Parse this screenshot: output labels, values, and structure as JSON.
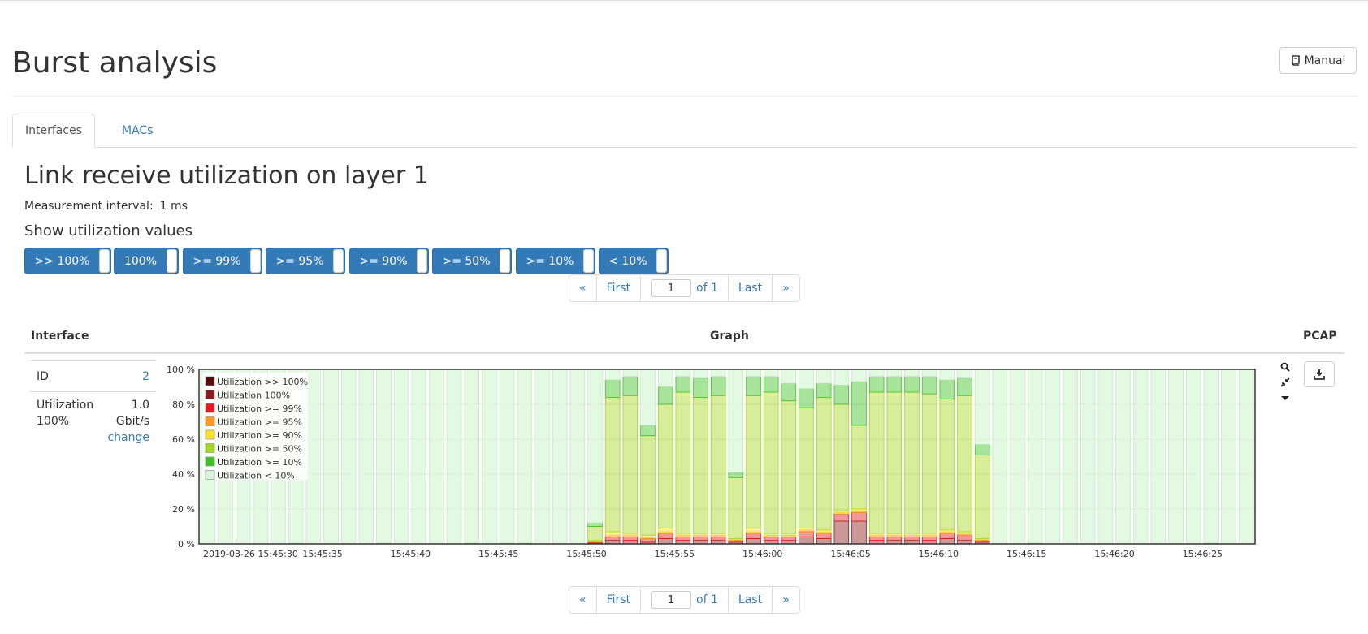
{
  "page": {
    "title": "Burst analysis",
    "manual_label": "Manual"
  },
  "tabs": [
    {
      "label": "Interfaces",
      "active": true
    },
    {
      "label": "MACs",
      "active": false
    }
  ],
  "section": {
    "title": "Link receive utilization on layer 1",
    "interval_label": "Measurement interval:",
    "interval_value": "1 ms",
    "show_title": "Show utilization values"
  },
  "toggles": [
    ">> 100%",
    "100%",
    ">= 99%",
    ">= 95%",
    ">= 90%",
    ">= 50%",
    ">= 10%",
    "< 10%"
  ],
  "pagination": {
    "prev": "«",
    "first": "First",
    "page": "1",
    "of": "of 1",
    "last": "Last",
    "next": "»"
  },
  "table": {
    "headers": {
      "interface": "Interface",
      "graph": "Graph",
      "pcap": "PCAP"
    },
    "interface": {
      "id_label": "ID",
      "id_value": "2",
      "util_label1": "Utilization",
      "util_label2": "100%",
      "util_value1": "1.0",
      "util_value2": "Gbit/s",
      "change": "change"
    }
  },
  "colors": {
    "accent": "#337ab7",
    "gt100": "#5a0808",
    "eq100": "#8b1a1a",
    "ge99": "#e41a1c",
    "ge95": "#ff9a1a",
    "ge90": "#ffe021",
    "ge50": "#a6d81e",
    "ge10": "#3ec422",
    "lt10": "#d9f6d6"
  },
  "chart_data": {
    "type": "bar",
    "stacked": true,
    "y_unit": "%",
    "ylim": [
      0,
      100
    ],
    "y_ticks": [
      "0 %",
      "20 %",
      "40 %",
      "60 %",
      "80 %",
      "100 %"
    ],
    "x_tick_labels": [
      "2019-03-26 15:45:30",
      "15:45:35",
      "15:45:40",
      "15:45:45",
      "15:45:50",
      "15:45:55",
      "15:46:00",
      "15:46:05",
      "15:46:10",
      "15:46:15",
      "15:46:20",
      "15:46:25"
    ],
    "x_start_label": "2019-03-26 15:45:30",
    "bar_interval_seconds": 1,
    "legend_position": "top-left",
    "series": [
      {
        "name": "Utilization >> 100%",
        "color": "#5a0808"
      },
      {
        "name": "Utilization 100%",
        "color": "#8b1a1a"
      },
      {
        "name": "Utilization >= 99%",
        "color": "#e41a1c"
      },
      {
        "name": "Utilization >= 95%",
        "color": "#ff9a1a"
      },
      {
        "name": "Utilization >= 90%",
        "color": "#ffe021"
      },
      {
        "name": "Utilization >= 50%",
        "color": "#a6d81e"
      },
      {
        "name": "Utilization >= 10%",
        "color": "#3ec422"
      },
      {
        "name": "Utilization < 10%",
        "color": "#d9f6d6"
      }
    ],
    "bars": [
      {
        "t": 0,
        "p": [
          0,
          0,
          0,
          0,
          0,
          0,
          0,
          100
        ]
      },
      {
        "t": 1,
        "p": [
          0,
          0,
          0,
          0,
          0,
          0,
          0,
          100
        ]
      },
      {
        "t": 2,
        "p": [
          0,
          0,
          0,
          0,
          0,
          0,
          0,
          100
        ]
      },
      {
        "t": 3,
        "p": [
          0,
          0,
          0,
          0,
          0,
          0,
          0,
          100
        ]
      },
      {
        "t": 4,
        "p": [
          0,
          0,
          0,
          0,
          0,
          0,
          0,
          100
        ]
      },
      {
        "t": 5,
        "p": [
          0,
          0,
          0,
          0,
          0,
          0,
          0.5,
          99.5
        ]
      },
      {
        "t": 6,
        "p": [
          0,
          0,
          0,
          0,
          0,
          0,
          0,
          100
        ]
      },
      {
        "t": 7,
        "p": [
          0,
          0,
          0,
          0,
          0,
          0,
          0,
          100
        ]
      },
      {
        "t": 8,
        "p": [
          0,
          0,
          0,
          0,
          0,
          0,
          0,
          100
        ]
      },
      {
        "t": 9,
        "p": [
          0,
          0,
          0,
          0,
          0,
          0,
          0,
          100
        ]
      },
      {
        "t": 10,
        "p": [
          0,
          0,
          0,
          0,
          0,
          0,
          0.5,
          99.5
        ]
      },
      {
        "t": 11,
        "p": [
          0,
          0,
          0,
          0,
          0,
          0,
          0,
          100
        ]
      },
      {
        "t": 12,
        "p": [
          0,
          0,
          0,
          0,
          0,
          0,
          0,
          100
        ]
      },
      {
        "t": 13,
        "p": [
          0,
          0,
          0,
          0,
          0,
          0,
          0,
          100
        ]
      },
      {
        "t": 14,
        "p": [
          0,
          0,
          0,
          0,
          0,
          0,
          0,
          100
        ]
      },
      {
        "t": 15,
        "p": [
          0,
          0,
          0,
          0,
          0,
          0,
          0.5,
          99.5
        ]
      },
      {
        "t": 16,
        "p": [
          0,
          0,
          0,
          0,
          0,
          0,
          0,
          100
        ]
      },
      {
        "t": 17,
        "p": [
          0,
          0,
          0,
          0,
          0,
          0,
          0.5,
          99.5
        ]
      },
      {
        "t": 18,
        "p": [
          0,
          0,
          0,
          0,
          0,
          0,
          0.5,
          99.5
        ]
      },
      {
        "t": 19,
        "p": [
          0,
          0,
          0,
          0,
          0,
          0,
          0,
          100
        ]
      },
      {
        "t": 20,
        "p": [
          0,
          0,
          0,
          0,
          0,
          0,
          0,
          100
        ]
      },
      {
        "t": 21,
        "p": [
          0,
          0,
          0,
          0,
          0,
          0,
          0,
          100
        ]
      },
      {
        "t": 22,
        "p": [
          0,
          0.5,
          0.5,
          0.5,
          0.5,
          8,
          2,
          88
        ]
      },
      {
        "t": 23,
        "p": [
          0,
          2,
          2,
          1,
          2,
          77,
          10,
          6
        ]
      },
      {
        "t": 24,
        "p": [
          0,
          2,
          2,
          1,
          1,
          79,
          11,
          4
        ]
      },
      {
        "t": 25,
        "p": [
          0,
          1,
          2,
          1,
          1,
          57,
          6,
          32
        ]
      },
      {
        "t": 26,
        "p": [
          0,
          3,
          3,
          1,
          2,
          71,
          10,
          10
        ]
      },
      {
        "t": 27,
        "p": [
          0,
          2,
          2,
          1,
          1,
          81,
          9,
          4
        ]
      },
      {
        "t": 28,
        "p": [
          0,
          2,
          2,
          1,
          1,
          78,
          11,
          5
        ]
      },
      {
        "t": 29,
        "p": [
          0,
          2,
          2,
          1,
          1,
          79,
          11,
          4
        ]
      },
      {
        "t": 30,
        "p": [
          0,
          1,
          1,
          0.5,
          0.5,
          35,
          3,
          59
        ]
      },
      {
        "t": 31,
        "p": [
          0,
          3,
          3,
          1,
          2,
          76,
          11,
          4
        ]
      },
      {
        "t": 32,
        "p": [
          0,
          2,
          2,
          1,
          1,
          81,
          9,
          4
        ]
      },
      {
        "t": 33,
        "p": [
          0,
          2,
          2,
          1,
          1,
          76,
          10,
          8
        ]
      },
      {
        "t": 34,
        "p": [
          0,
          4,
          3,
          1,
          1,
          69,
          11,
          11
        ]
      },
      {
        "t": 35,
        "p": [
          0,
          3,
          3,
          1,
          1,
          76,
          8,
          8
        ]
      },
      {
        "t": 36,
        "p": [
          0,
          13,
          4,
          1,
          1,
          61,
          11,
          9
        ]
      },
      {
        "t": 37,
        "p": [
          0,
          13,
          5,
          1,
          1,
          48,
          25,
          7
        ]
      },
      {
        "t": 38,
        "p": [
          0,
          2,
          2,
          1,
          1,
          81,
          9,
          4
        ]
      },
      {
        "t": 39,
        "p": [
          0,
          2,
          2,
          1,
          1,
          81,
          9,
          4
        ]
      },
      {
        "t": 40,
        "p": [
          0,
          2,
          2,
          1,
          1,
          81,
          9,
          4
        ]
      },
      {
        "t": 41,
        "p": [
          0,
          2,
          2,
          1,
          1,
          80,
          10,
          4
        ]
      },
      {
        "t": 42,
        "p": [
          0,
          3,
          3,
          1,
          1,
          75,
          11,
          6
        ]
      },
      {
        "t": 43,
        "p": [
          0,
          2,
          3,
          1,
          1,
          78,
          10,
          5
        ]
      },
      {
        "t": 44,
        "p": [
          0,
          1,
          1,
          0.5,
          0.5,
          48,
          6,
          43
        ]
      },
      {
        "t": 45,
        "p": [
          0,
          0,
          0,
          0,
          0,
          0,
          0,
          100
        ]
      },
      {
        "t": 46,
        "p": [
          0,
          0,
          0,
          0,
          0,
          0,
          0,
          100
        ]
      },
      {
        "t": 47,
        "p": [
          0,
          0,
          0,
          0,
          0,
          0,
          0.5,
          99.5
        ]
      },
      {
        "t": 48,
        "p": [
          0,
          0,
          0,
          0,
          0,
          0,
          0,
          100
        ]
      },
      {
        "t": 49,
        "p": [
          0,
          0,
          0,
          0,
          0,
          0,
          0,
          100
        ]
      },
      {
        "t": 50,
        "p": [
          0,
          0,
          0,
          0,
          0,
          0,
          0,
          100
        ]
      },
      {
        "t": 51,
        "p": [
          0,
          0,
          0,
          0,
          0,
          0,
          0,
          100
        ]
      },
      {
        "t": 52,
        "p": [
          0,
          0,
          0,
          0,
          0,
          0,
          0,
          100
        ]
      },
      {
        "t": 53,
        "p": [
          0,
          0,
          0,
          0,
          0,
          0,
          0,
          100
        ]
      },
      {
        "t": 54,
        "p": [
          0,
          0,
          0,
          0,
          0,
          0,
          0,
          100
        ]
      },
      {
        "t": 55,
        "p": [
          0,
          0,
          0,
          0,
          0,
          0,
          0,
          100
        ]
      },
      {
        "t": 56,
        "p": [
          0,
          0,
          0,
          0,
          0,
          0,
          0,
          100
        ]
      },
      {
        "t": 57,
        "p": [
          0,
          0,
          0,
          0,
          0,
          0,
          0.5,
          99.5
        ]
      },
      {
        "t": 58,
        "p": [
          0,
          0,
          0,
          0,
          0,
          0,
          0,
          100
        ]
      },
      {
        "t": 59,
        "p": [
          0,
          0,
          0,
          0,
          0,
          0,
          0,
          100
        ]
      }
    ]
  }
}
